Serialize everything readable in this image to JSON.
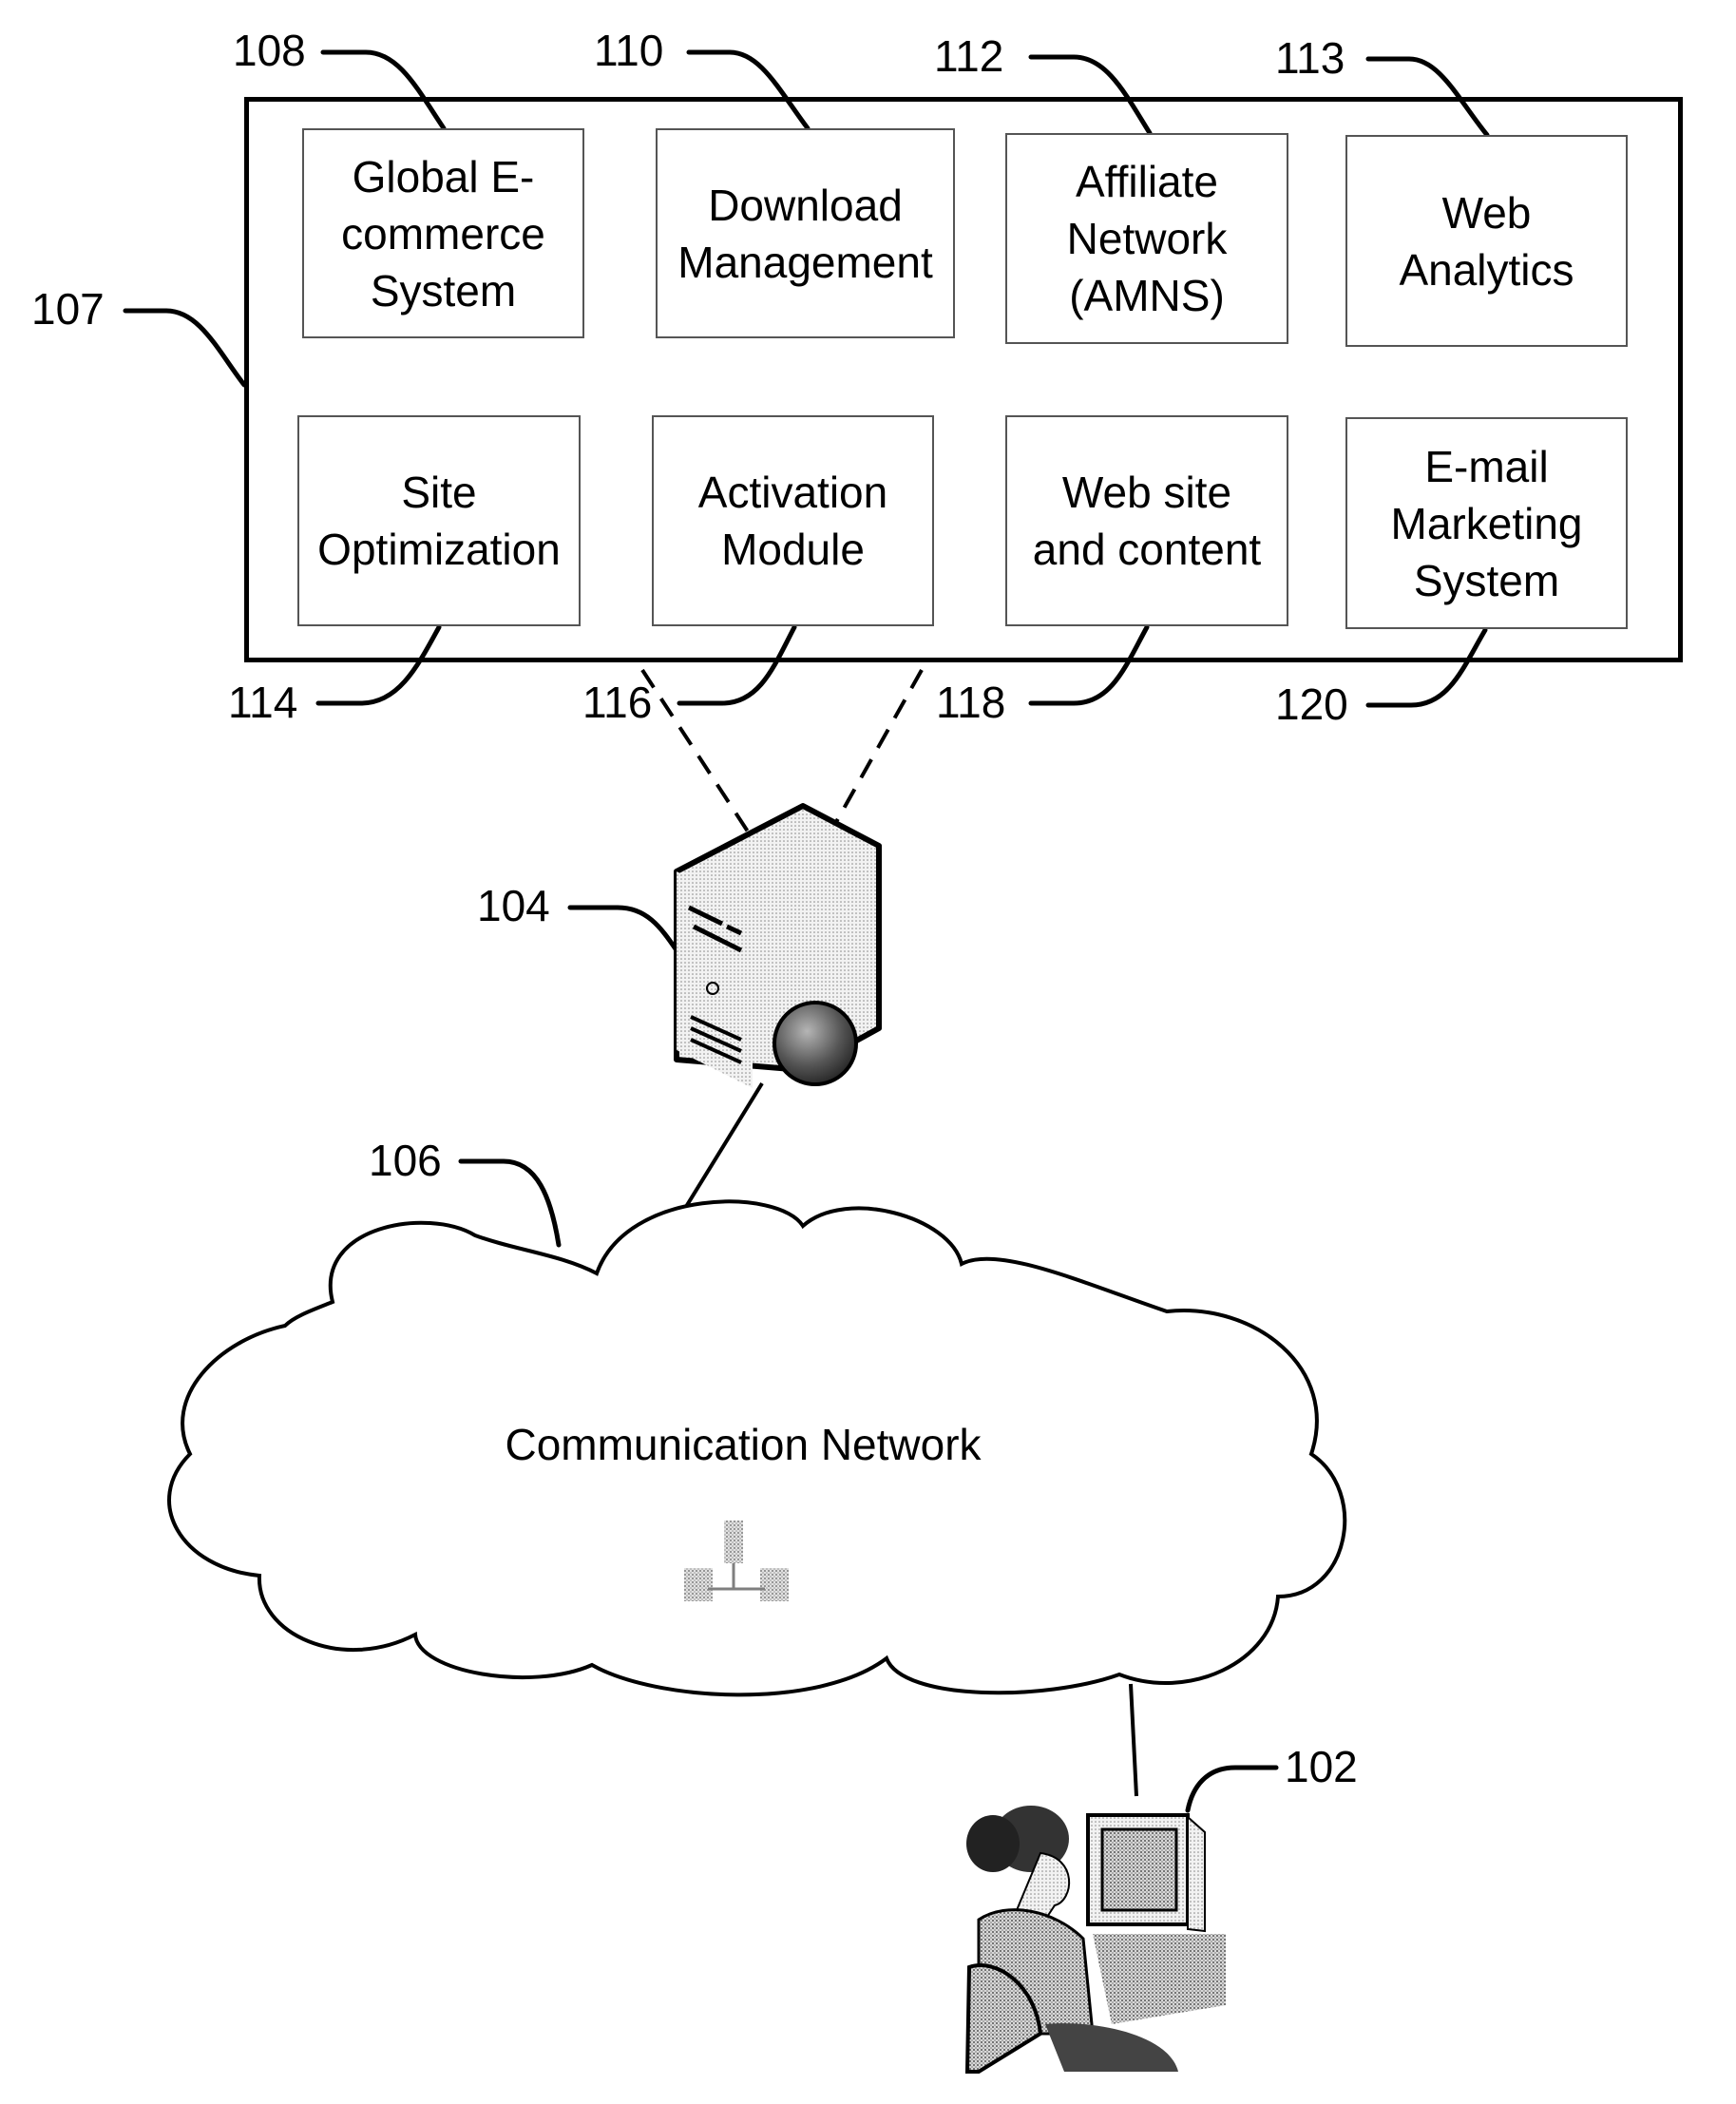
{
  "diagram": {
    "container": {
      "ref": "107"
    },
    "modules": [
      {
        "ref": "108",
        "label": "Global E-\ncommerce\nSystem"
      },
      {
        "ref": "110",
        "label": "Download\nManagement"
      },
      {
        "ref": "112",
        "label": "Affiliate\nNetwork\n(AMNS)"
      },
      {
        "ref": "113",
        "label": "Web\nAnalytics"
      },
      {
        "ref": "114",
        "label": "Site\nOptimization"
      },
      {
        "ref": "116",
        "label": "Activation\nModule"
      },
      {
        "ref": "118",
        "label": "Web site\nand content"
      },
      {
        "ref": "120",
        "label": "E-mail\nMarketing\nSystem"
      }
    ],
    "server": {
      "ref": "104",
      "icon": "server-icon"
    },
    "network": {
      "ref": "106",
      "label": "Communication Network",
      "icon": "network-icon"
    },
    "user": {
      "ref": "102",
      "icon": "user-at-computer-icon"
    }
  }
}
